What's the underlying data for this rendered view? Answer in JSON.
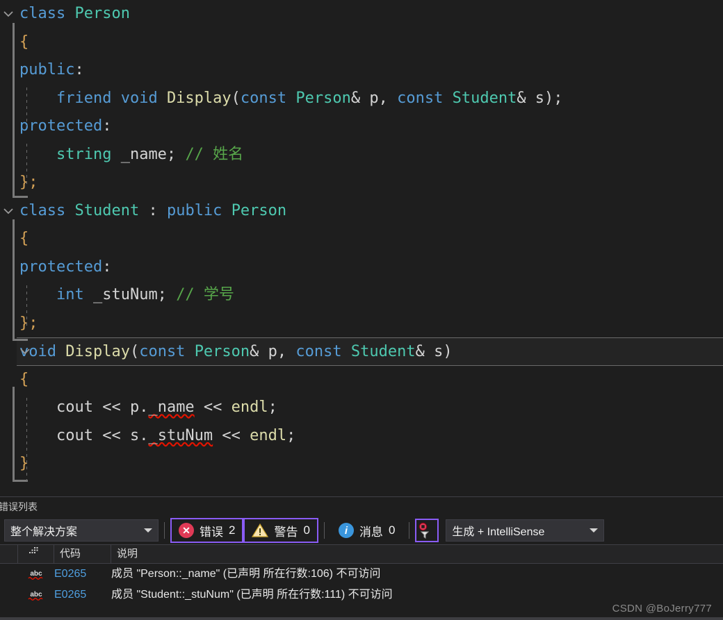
{
  "editor": {
    "lines": [
      {
        "id": "l1",
        "fold": "chevron-down-icon",
        "indent": 0,
        "tokens": [
          {
            "t": "class",
            "c": "kw"
          },
          {
            "t": " ",
            "c": "plain"
          },
          {
            "t": "Person",
            "c": "typ"
          }
        ]
      },
      {
        "id": "l2",
        "indent": 1,
        "tokens": [
          {
            "t": "{",
            "c": "brace"
          }
        ]
      },
      {
        "id": "l3",
        "indent": 1,
        "tokens": [
          {
            "t": "public",
            "c": "kw"
          },
          {
            "t": ":",
            "c": "plain"
          }
        ]
      },
      {
        "id": "l4",
        "indent": 2,
        "tokens": [
          {
            "t": "    friend",
            "c": "kw"
          },
          {
            "t": " ",
            "c": "plain"
          },
          {
            "t": "void",
            "c": "kw"
          },
          {
            "t": " ",
            "c": "plain"
          },
          {
            "t": "Display",
            "c": "fn"
          },
          {
            "t": "(",
            "c": "pun"
          },
          {
            "t": "const",
            "c": "kw"
          },
          {
            "t": " ",
            "c": "plain"
          },
          {
            "t": "Person",
            "c": "typ"
          },
          {
            "t": "&",
            "c": "pun"
          },
          {
            "t": " p, ",
            "c": "plain"
          },
          {
            "t": "const",
            "c": "kw"
          },
          {
            "t": " ",
            "c": "plain"
          },
          {
            "t": "Student",
            "c": "typ"
          },
          {
            "t": "&",
            "c": "pun"
          },
          {
            "t": " s);",
            "c": "plain"
          }
        ]
      },
      {
        "id": "l5",
        "indent": 1,
        "tokens": [
          {
            "t": "protected",
            "c": "kw"
          },
          {
            "t": ":",
            "c": "plain"
          }
        ]
      },
      {
        "id": "l6",
        "indent": 2,
        "tokens": [
          {
            "t": "    string",
            "c": "typ"
          },
          {
            "t": " ",
            "c": "plain"
          },
          {
            "t": "_name;",
            "c": "plain"
          },
          {
            "t": " ",
            "c": "plain"
          },
          {
            "t": "// 姓名",
            "c": "cmt"
          }
        ]
      },
      {
        "id": "l7",
        "indent": 1,
        "foldEnd": true,
        "tokens": [
          {
            "t": "};",
            "c": "brace"
          }
        ]
      },
      {
        "id": "l8",
        "fold": "chevron-down-icon",
        "indent": 0,
        "tokens": [
          {
            "t": "class",
            "c": "kw"
          },
          {
            "t": " ",
            "c": "plain"
          },
          {
            "t": "Student",
            "c": "typ"
          },
          {
            "t": " : ",
            "c": "plain"
          },
          {
            "t": "public",
            "c": "kw"
          },
          {
            "t": " ",
            "c": "plain"
          },
          {
            "t": "Person",
            "c": "typ"
          }
        ]
      },
      {
        "id": "l9",
        "indent": 1,
        "tokens": [
          {
            "t": "{",
            "c": "brace"
          }
        ]
      },
      {
        "id": "l10",
        "indent": 1,
        "tokens": [
          {
            "t": "protected",
            "c": "kw"
          },
          {
            "t": ":",
            "c": "plain"
          }
        ]
      },
      {
        "id": "l11",
        "indent": 2,
        "tokens": [
          {
            "t": "    int",
            "c": "kw"
          },
          {
            "t": " ",
            "c": "plain"
          },
          {
            "t": "_stuNum;",
            "c": "plain"
          },
          {
            "t": " ",
            "c": "plain"
          },
          {
            "t": "// 学号",
            "c": "cmt"
          }
        ]
      },
      {
        "id": "l12",
        "indent": 1,
        "foldEnd": true,
        "tokens": [
          {
            "t": "};",
            "c": "brace"
          }
        ]
      },
      {
        "id": "l13",
        "fold": "chevron-down-icon",
        "current": true,
        "indent": 0,
        "tokens": [
          {
            "t": "void",
            "c": "kw"
          },
          {
            "t": " ",
            "c": "plain"
          },
          {
            "t": "Display",
            "c": "fn"
          },
          {
            "t": "(",
            "c": "pun"
          },
          {
            "t": "const",
            "c": "kw"
          },
          {
            "t": " ",
            "c": "plain"
          },
          {
            "t": "Person",
            "c": "typ"
          },
          {
            "t": "&",
            "c": "pun"
          },
          {
            "t": " p, ",
            "c": "plain"
          },
          {
            "t": "const",
            "c": "kw"
          },
          {
            "t": " ",
            "c": "plain"
          },
          {
            "t": "Student",
            "c": "typ"
          },
          {
            "t": "&",
            "c": "pun"
          },
          {
            "t": " s)",
            "c": "plain"
          }
        ]
      },
      {
        "id": "l14",
        "indent": 1,
        "tokens": [
          {
            "t": "{",
            "c": "brace"
          }
        ]
      },
      {
        "id": "l15",
        "indent": 2,
        "tokens": [
          {
            "t": "    cout",
            "c": "plain"
          },
          {
            "t": " << p.",
            "c": "plain"
          },
          {
            "t": "_name",
            "c": "plain",
            "squiggle": true
          },
          {
            "t": " << ",
            "c": "plain"
          },
          {
            "t": "endl",
            "c": "fn"
          },
          {
            "t": ";",
            "c": "plain"
          }
        ]
      },
      {
        "id": "l16",
        "indent": 2,
        "tokens": [
          {
            "t": "    cout",
            "c": "plain"
          },
          {
            "t": " << s.",
            "c": "plain"
          },
          {
            "t": "_stuNum",
            "c": "plain",
            "squiggle": true
          },
          {
            "t": " << ",
            "c": "plain"
          },
          {
            "t": "endl",
            "c": "fn"
          },
          {
            "t": ";",
            "c": "plain"
          }
        ]
      },
      {
        "id": "l17",
        "indent": 1,
        "foldEnd": true,
        "tokens": [
          {
            "t": "}",
            "c": "brace"
          }
        ]
      }
    ]
  },
  "error_panel": {
    "title": "错误列表",
    "scope_filter": {
      "value": "整个解决方案",
      "icon": "chevron-down-icon"
    },
    "severities": [
      {
        "key": "errors",
        "icon": "error-icon",
        "label": "错误",
        "count": "2",
        "boxed": true
      },
      {
        "key": "warnings",
        "icon": "warning-icon",
        "label": "警告",
        "count": "0",
        "boxed": true
      },
      {
        "key": "messages",
        "icon": "info-icon",
        "label": "消息",
        "count": "0",
        "boxed": false
      }
    ],
    "filter_button": {
      "icon": "filter-funnel-icon",
      "boxed": true
    },
    "build_filter": {
      "value": "生成 + IntelliSense",
      "icon": "chevron-down-icon"
    },
    "columns": [
      "",
      "",
      "代码",
      "说明"
    ],
    "rows": [
      {
        "icon": "abc-squiggle-icon",
        "code": "E0265",
        "description": "成员 \"Person::_name\" (已声明 所在行数:106) 不可访问"
      },
      {
        "icon": "abc-squiggle-icon",
        "code": "E0265",
        "description": "成员 \"Student::_stuNum\" (已声明 所在行数:111) 不可访问"
      }
    ]
  },
  "watermark": "CSDN @BoJerry777",
  "colors": {
    "background": "#1e1e1e",
    "keyword": "#569cd6",
    "type": "#4ec9b0",
    "function": "#dcdcaa",
    "comment": "#57a64a",
    "text": "#d4d4d4",
    "error_red": "#e03a56",
    "warning_yellow": "#f5deb3",
    "info_blue": "#3a96dd",
    "highlight_purple": "#8a5cf5",
    "code_link_blue": "#4f9fe0"
  }
}
